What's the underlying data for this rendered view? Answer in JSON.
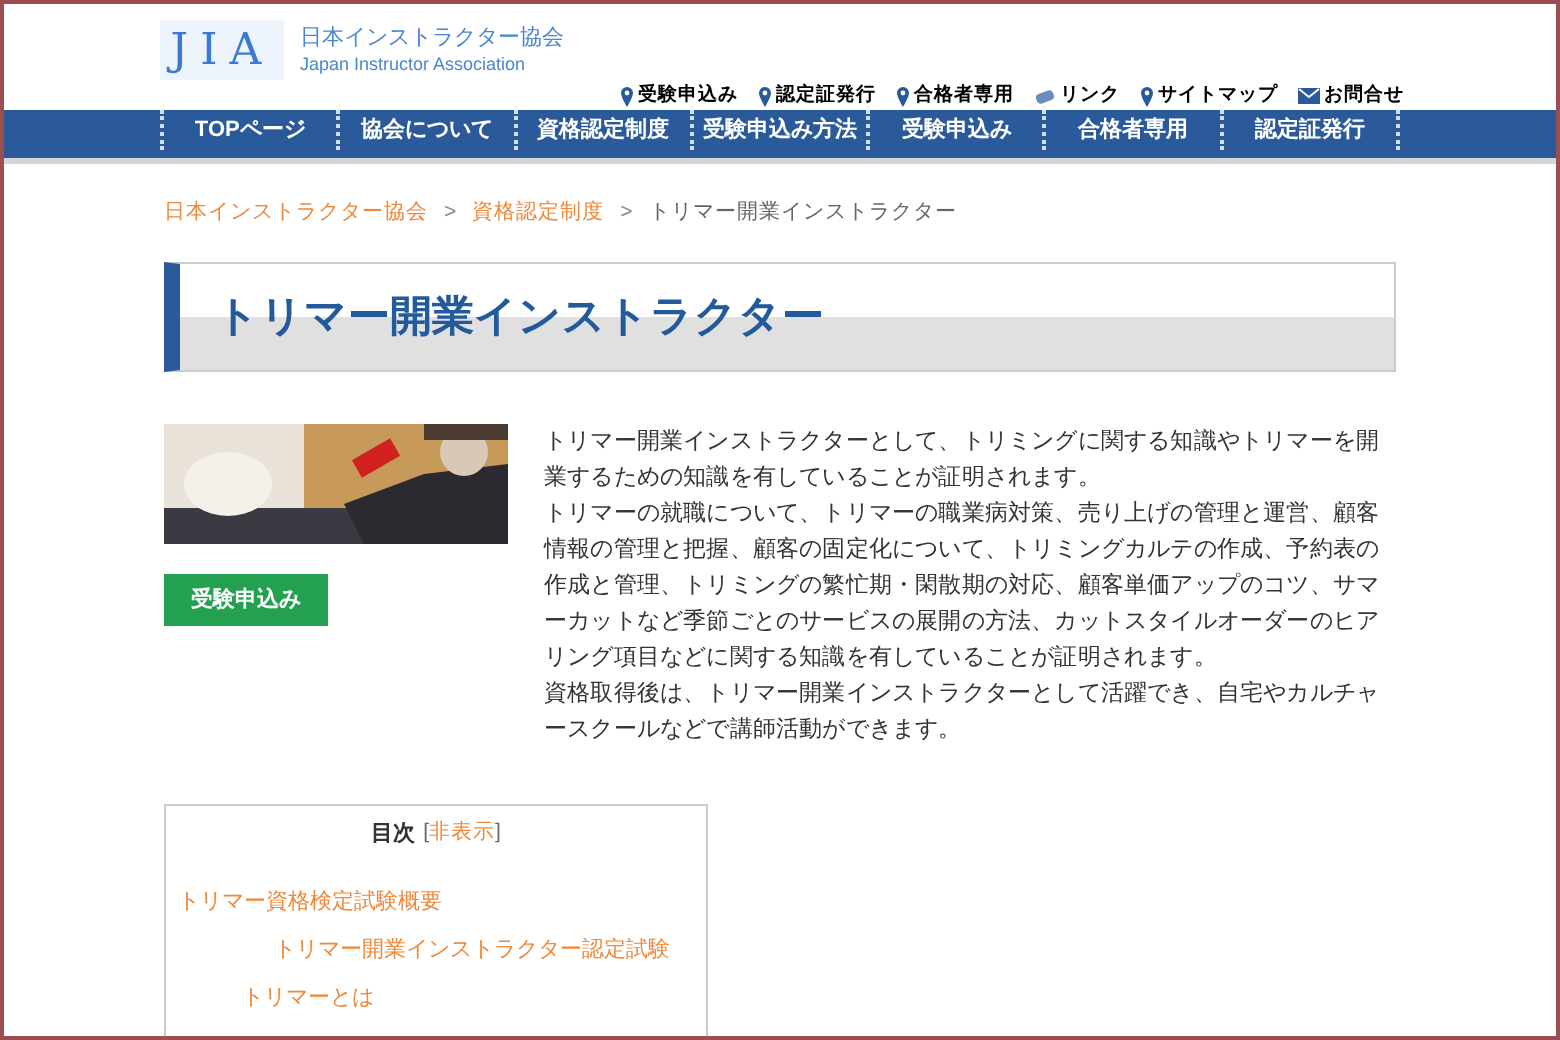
{
  "logo": {
    "mark": "JIA",
    "name": "日本インストラクター協会",
    "name_en": "Japan Instructor Association"
  },
  "top_links": [
    {
      "label": "受験申込み",
      "kind": "pin"
    },
    {
      "label": "認定証発行",
      "kind": "pin"
    },
    {
      "label": "合格者専用",
      "kind": "pin"
    },
    {
      "label": "リンク",
      "kind": "clip"
    },
    {
      "label": "サイトマップ",
      "kind": "pin"
    },
    {
      "label": "お問合せ",
      "kind": "mail"
    }
  ],
  "nav": [
    "TOPページ",
    "協会について",
    "資格認定制度",
    "受験申込み方法",
    "受験申込み",
    "合格者専用",
    "認定証発行"
  ],
  "breadcrumb": [
    {
      "label": "日本インストラクター協会",
      "link": true
    },
    {
      "label": "資格認定制度",
      "link": true
    },
    {
      "label": "トリマー開業インストラクター",
      "link": false
    }
  ],
  "separator": ">",
  "heading": "トリマー開業インストラクター",
  "apply_button": "受験申込み",
  "paragraphs": [
    "トリマー開業インストラクターとして、トリミングに関する知識やトリマーを開業するための知識を有していることが証明されます。",
    "トリマーの就職について、トリマーの職業病対策、売り上げの管理と運営、顧客情報の管理と把握、顧客の固定化について、トリミングカルテの作成、予約表の作成と管理、トリミングの繁忙期・閑散期の対応、顧客単価アップのコツ、サマーカットなど季節ごとのサービスの展開の方法、カットスタイルオーダーのヒアリング項目などに関する知識を有していることが証明されます。",
    "資格取得後は、トリマー開業インストラクターとして活躍でき、自宅やカルチャースクールなどで講師活動ができます。"
  ],
  "toc": {
    "title": "目次",
    "bracket_open": "[",
    "toggle": "非表示",
    "bracket_close": "]",
    "items": [
      {
        "label": "トリマー資格検定試験概要",
        "children": [
          {
            "label": "トリマー開業インストラクター認定試験"
          }
        ]
      },
      {
        "label": "トリマーとは",
        "indent": true
      }
    ]
  }
}
